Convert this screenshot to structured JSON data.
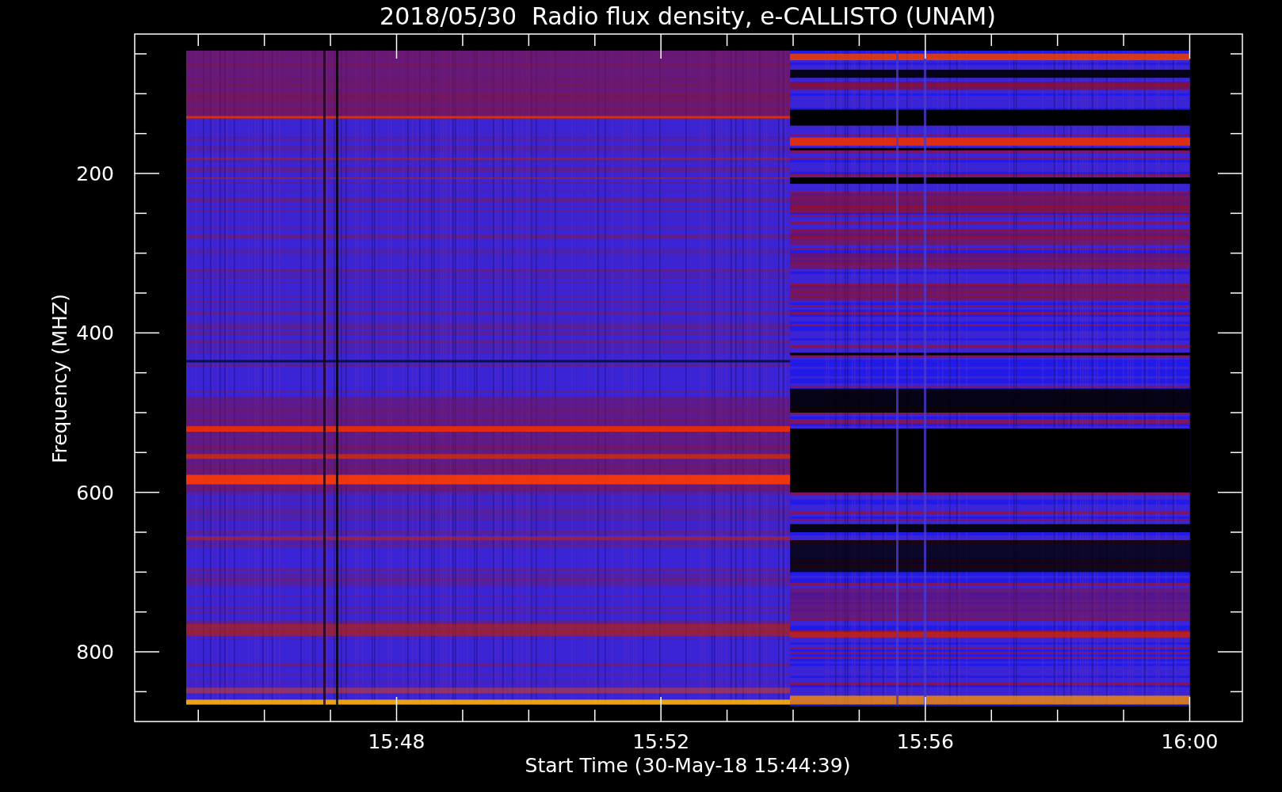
{
  "title": "2018/05/30  Radio flux density, e-CALLISTO (UNAM)",
  "y_axis": {
    "label": "Frequency (MHZ)",
    "ticks": [
      "200",
      "400",
      "600",
      "800"
    ]
  },
  "x_axis": {
    "label": "Start Time (30-May-18 15:44:39)",
    "ticks": [
      "15:48",
      "15:52",
      "15:56",
      "16:00"
    ]
  }
}
